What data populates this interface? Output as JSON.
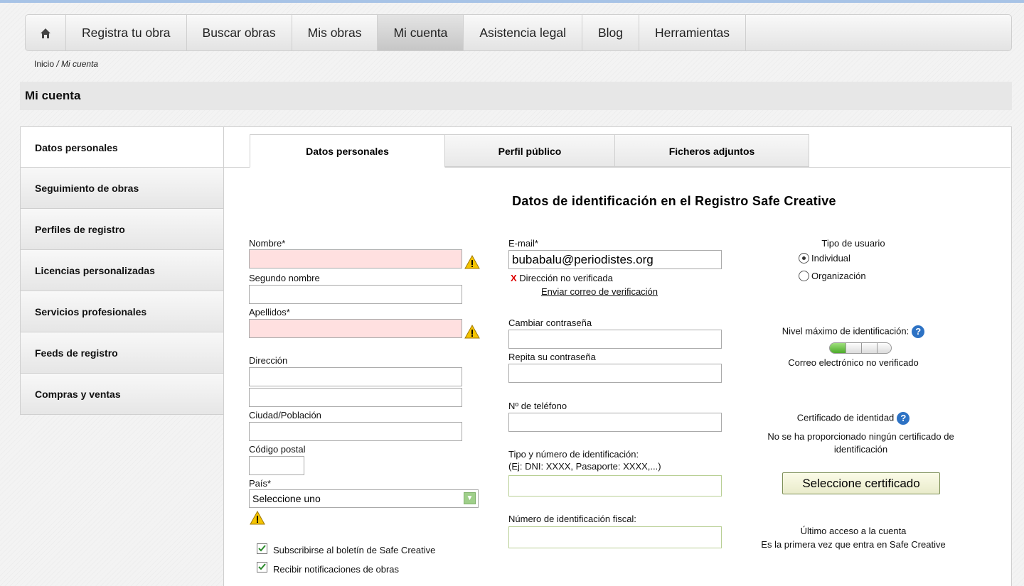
{
  "nav": {
    "home_icon": "home-icon",
    "items": [
      "Registra tu obra",
      "Buscar obras",
      "Mis obras",
      "Mi cuenta",
      "Asistencia legal",
      "Blog",
      "Herramientas"
    ],
    "active": "Mi cuenta"
  },
  "breadcrumb": {
    "root": "Inicio",
    "separator": "/",
    "current": "Mi cuenta"
  },
  "page_title": "Mi cuenta",
  "sidebar": {
    "items": [
      "Datos personales",
      "Seguimiento de obras",
      "Perfiles de registro",
      "Licencias personalizadas",
      "Servicios profesionales",
      "Feeds de registro",
      "Compras y ventas"
    ],
    "active": "Datos personales"
  },
  "tabs": [
    "Datos personales",
    "Perfil público",
    "Ficheros adjuntos"
  ],
  "heading": "Datos de identificación en el Registro Safe Creative",
  "left": {
    "nombre_label": "Nombre*",
    "nombre_value": "",
    "segundo_label": "Segundo nombre",
    "segundo_value": "",
    "apellidos_label": "Apellidos*",
    "apellidos_value": "",
    "direccion_label": "Dirección",
    "direccion1_value": "",
    "direccion2_value": "",
    "ciudad_label": "Ciudad/Población",
    "ciudad_value": "",
    "cp_label": "Código postal",
    "cp_value": "",
    "pais_label": "País*",
    "pais_value": "Seleccione uno",
    "newsletter_label": "Subscribirse al boletín de Safe Creative",
    "newsletter_checked": true,
    "notif_label": "Recibir notificaciones de obras",
    "notif_checked": true
  },
  "middle": {
    "email_label": "E-mail*",
    "email_value": "bubabalu@periodistes.org",
    "unverified_mark": "X",
    "unverified_text": "Dirección no verificada",
    "verify_link": "Enviar correo de verificación",
    "password_label": "Cambiar contraseña",
    "password_value": "",
    "repeat_label": "Repita su contraseña",
    "repeat_value": "",
    "phone_label": "Nº de teléfono",
    "phone_value": "",
    "id_label_1": "Tipo y número de identificación:",
    "id_label_2": "(Ej: DNI: XXXX, Pasaporte: XXXX,...)",
    "id_value": "",
    "fiscal_label": "Número de identificación fiscal:",
    "fiscal_value": ""
  },
  "right": {
    "user_type_label": "Tipo de usuario",
    "options": [
      "Individual",
      "Organización"
    ],
    "selected": "Individual",
    "level_label": "Nivel máximo de identificación:",
    "level_fraction": 0.25,
    "level_segments": 4,
    "level_status": "Correo electrónico no verificado",
    "cert_label": "Certificado de identidad",
    "cert_status": "No se ha proporcionado ningún certificado de identificación",
    "cert_button": "Seleccione certificado",
    "last_access_label": "Último acceso a la cuenta",
    "last_access_value": "Es la primera vez que entra en Safe Creative"
  },
  "colors": {
    "required_bg": "#ffe0e0",
    "help_icon": "#2d72c4",
    "level_fill": "#4caa29"
  }
}
